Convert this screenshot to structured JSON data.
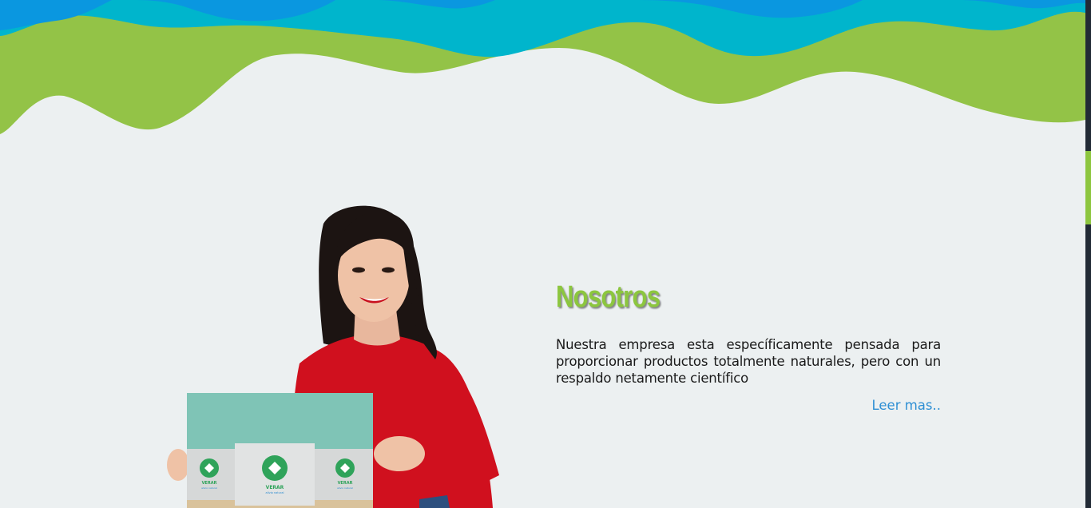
{
  "theme": {
    "wave_dark_blue": "#0a97e0",
    "wave_teal": "#00b5cc",
    "wave_green": "#93c347",
    "background": "#ecf0f1",
    "title_color": "#8cc63f",
    "link_color": "#2e8fd4",
    "scrollbar_thumb": "#8dc63f"
  },
  "about": {
    "title": "Nosotros",
    "description": "Nuestra empresa esta específicamente pensada para proporcionar productos totalmente naturales, pero con un respaldo netamente científico",
    "read_more_label": "Leer mas.."
  },
  "product_boxes": {
    "brand": "VERAR",
    "tagline": "alivio natural"
  },
  "hero": {
    "image_description_icon": "woman-holding-product-icon"
  }
}
